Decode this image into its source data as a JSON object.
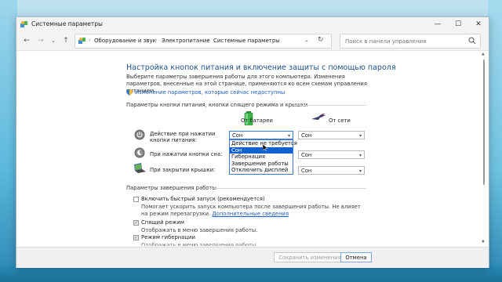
{
  "window": {
    "title": "Системные параметры",
    "controls": {
      "minimize": "—",
      "maximize": "☐",
      "close": "✕"
    }
  },
  "nav": {
    "back": "←",
    "forward": "→",
    "recent": "⌄",
    "up": "↑",
    "breadcrumbs": [
      "Оборудование и звук",
      "Электропитание",
      "Системные параметры"
    ],
    "separator": "›",
    "dropdown": "⌄",
    "refresh": "↻",
    "search_placeholder": "Поиск в панели управления"
  },
  "main": {
    "heading": "Настройка кнопок питания и включение защиты с помощью пароля",
    "description": "Выберите параметры завершения работы для этого компьютера. Изменения параметров, внесенные на этой странице, применяются ко всем схемам управления питанием.",
    "unavailable_link": "Изменение параметров, которые сейчас недоступны",
    "buttons_section": "Параметры кнопки питания, кнопки спящего режима и крышки",
    "col_battery": "От батареи",
    "col_ac": "От сети",
    "rows": [
      {
        "label": "Действие при нажатии кнопки питания:",
        "battery": "Сон",
        "ac": "Сон"
      },
      {
        "label": "При нажатии кнопки сна:",
        "battery": "",
        "ac": "Сон"
      },
      {
        "label": "При закрытии крышки:",
        "battery": "",
        "ac": "Сон"
      }
    ],
    "dropdown_options": [
      "Действие не требуется",
      "Сон",
      "Гибернация",
      "Завершение работы",
      "Отключить дисплей"
    ],
    "dropdown_selected_index": 1,
    "shutdown_section": "Параметры завершения работы",
    "fast_startup": {
      "label": "Включить быстрый запуск (рекомендуется)",
      "desc": "Помогает ускорить запуск компьютера после завершения работы. Не влияет на режим перезагрузки.",
      "link": "Дополнительные сведения",
      "checked": false
    },
    "sleep": {
      "label": "Спящий режим",
      "desc": "Отображать в меню завершения работы.",
      "checked": true
    },
    "hibernate": {
      "label": "Режим гибернации",
      "desc": "Отображать в меню завершения работы.",
      "checked": true
    }
  },
  "footer": {
    "save": "Сохранить изменения",
    "cancel": "Отмена"
  },
  "colors": {
    "accent": "#0f63d1",
    "heading": "#1c4f8a",
    "link": "#1f5fbf",
    "battery_green": "#3bb54a"
  }
}
